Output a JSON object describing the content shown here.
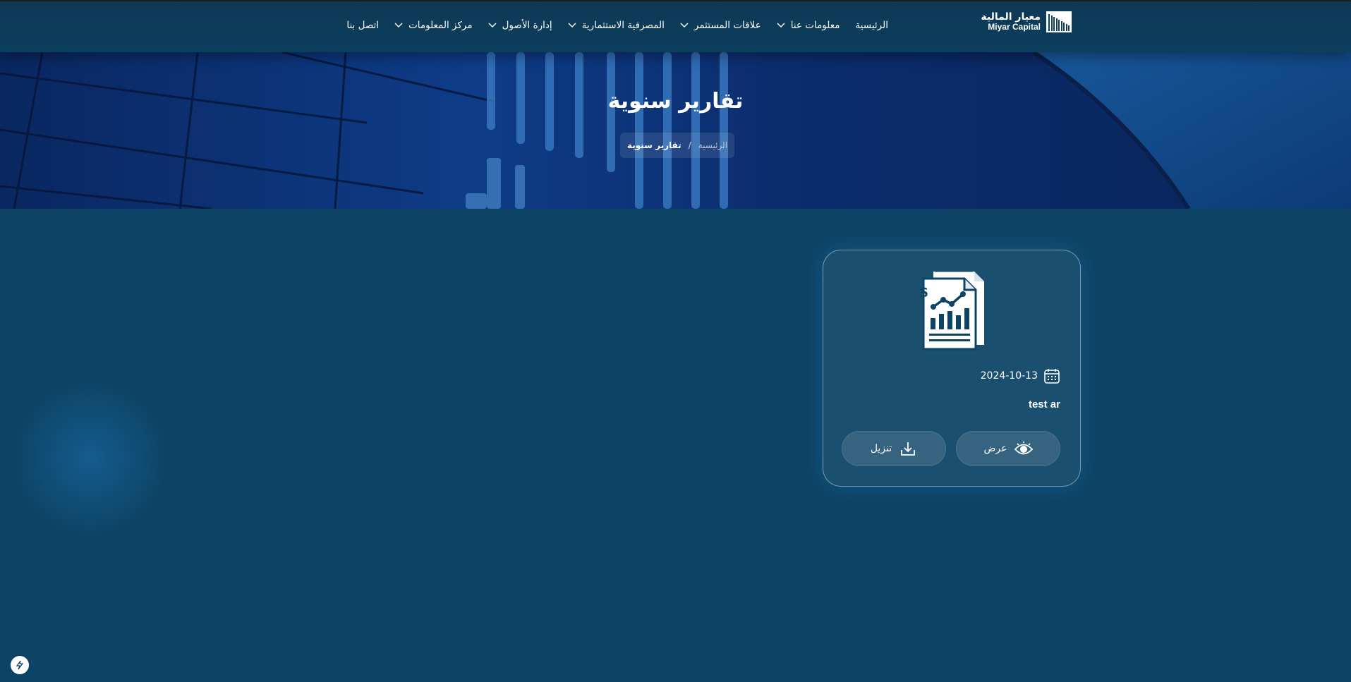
{
  "brand": {
    "name_ar": "معيار المالية",
    "name_en": "Miyar Capital",
    "logo_icon": "bar-lines-logo-icon"
  },
  "nav": {
    "items": [
      {
        "label": "الرئيسية",
        "dropdown": false
      },
      {
        "label": "معلومات عنا",
        "dropdown": true
      },
      {
        "label": "علاقات المستثمر",
        "dropdown": true
      },
      {
        "label": "المصرفية الاستثمارية",
        "dropdown": true
      },
      {
        "label": "إدارة الأصول",
        "dropdown": true
      },
      {
        "label": "مركز المعلومات",
        "dropdown": true
      },
      {
        "label": "اتصل بنا",
        "dropdown": false
      }
    ]
  },
  "hero": {
    "title": "تقارير سنوية",
    "breadcrumb": {
      "home": "الرئيسية",
      "separator": "/",
      "current": "تقارير سنوية"
    }
  },
  "card": {
    "icon": "financial-report-icon",
    "date": "2024-10-13",
    "title": "test ar",
    "view_label": "عرض",
    "download_label": "تنزيل"
  },
  "colors": {
    "background": "#0d4466",
    "header": "#0c3e5e",
    "hero": "#0d3a85",
    "text": "#ffffff"
  }
}
